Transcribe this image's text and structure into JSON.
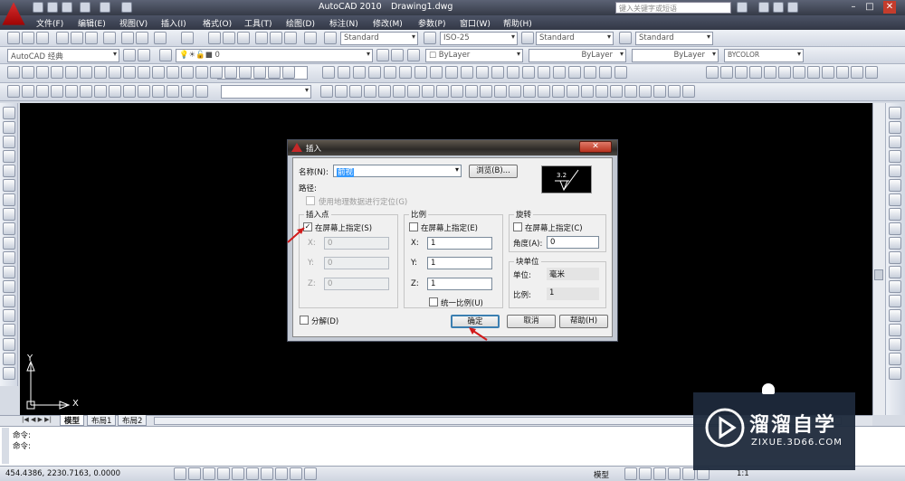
{
  "titlebar": {
    "app_title": "AutoCAD 2010",
    "doc_title": "Drawing1.dwg",
    "search_placeholder": "键入关键字或短语"
  },
  "menu": [
    "文件(F)",
    "编辑(E)",
    "视图(V)",
    "插入(I)",
    "格式(O)",
    "工具(T)",
    "绘图(D)",
    "标注(N)",
    "修改(M)",
    "参数(P)",
    "窗口(W)",
    "帮助(H)"
  ],
  "styles_toolbar": {
    "text_style": "Standard",
    "dim_style": "ISO-25",
    "table_style": "Standard",
    "mleader_style": "Standard"
  },
  "workspace_toolbar": {
    "workspace": "AutoCAD 经典",
    "layer": "0"
  },
  "properties_toolbar": {
    "color": "ByLayer",
    "linetype": "ByLayer",
    "lineweight": "ByLayer",
    "plotstyle": "BYCOLOR"
  },
  "ucs": {
    "y_label": "Y",
    "x_label": "X"
  },
  "tabs": [
    "模型",
    "布局1",
    "布局2"
  ],
  "command_lines": [
    "命令:",
    "命令:"
  ],
  "status": {
    "coords": "454.4386,   2230.7163, 0.0000",
    "model": "模型",
    "scale": "1:1"
  },
  "dialog": {
    "title": "插入",
    "name_label": "名称(N):",
    "name_value": "前视",
    "browse_button": "浏览(B)...",
    "path_label": "路径:",
    "geo_checkbox": "使用地理数据进行定位(G)",
    "insertion_group": "插入点",
    "insertion_onscreen": "在屏幕上指定(S)",
    "insertion_onscreen_checked": true,
    "insertion_x": "0",
    "insertion_y": "0",
    "insertion_z": "0",
    "scale_group": "比例",
    "scale_onscreen": "在屏幕上指定(E)",
    "scale_x": "1",
    "scale_y": "1",
    "scale_z": "1",
    "uniform_scale": "统一比例(U)",
    "rotation_group": "旋转",
    "rotation_onscreen": "在屏幕上指定(C)",
    "angle_label": "角度(A):",
    "angle_value": "0",
    "block_unit_group": "块单位",
    "unit_label": "单位:",
    "unit_value": "毫米",
    "factor_label": "比例:",
    "factor_value": "1",
    "explode_checkbox": "分解(D)",
    "ok_button": "确定",
    "cancel_button": "取消",
    "help_button": "帮助(H)",
    "preview_text": "3.2"
  },
  "watermark": {
    "title": "溜溜自学",
    "url": "ZIXUE.3D66.COM"
  },
  "colors": {
    "canvas": "#000000",
    "dialog_title": "#2d2a27",
    "annotation_arrow": "#d21a1a",
    "watermark_bg": "#1e2a3c"
  }
}
